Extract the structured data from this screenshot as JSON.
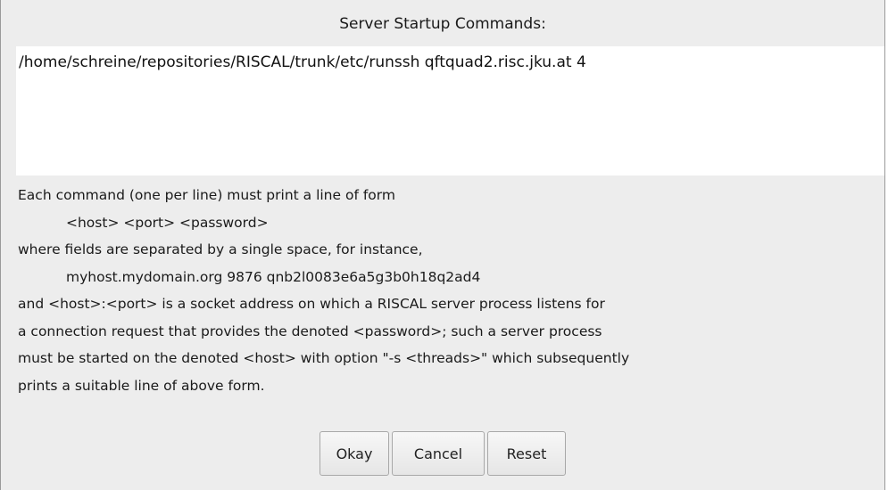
{
  "dialog": {
    "title": "Server Startup Commands:",
    "commands_value": "/home/schreine/repositories/RISCAL/trunk/etc/runssh qftquad2.risc.jku.at 4",
    "help_lines": [
      "Each command (one per line) must print a line of form",
      "<host> <port> <password>",
      "where fields are separated by a single space, for instance,",
      "myhost.mydomain.org 9876 qnb2l0083e6a5g3b0h18q2ad4",
      "and <host>:<port> is a socket address on which a RISCAL server process listens for",
      "a connection request that provides the denoted <password>; such a server process",
      "must be started on the denoted <host> with option \"-s <threads>\" which subsequently",
      "prints a suitable line of above form."
    ],
    "buttons": {
      "okay": "Okay",
      "cancel": "Cancel",
      "reset": "Reset"
    }
  }
}
